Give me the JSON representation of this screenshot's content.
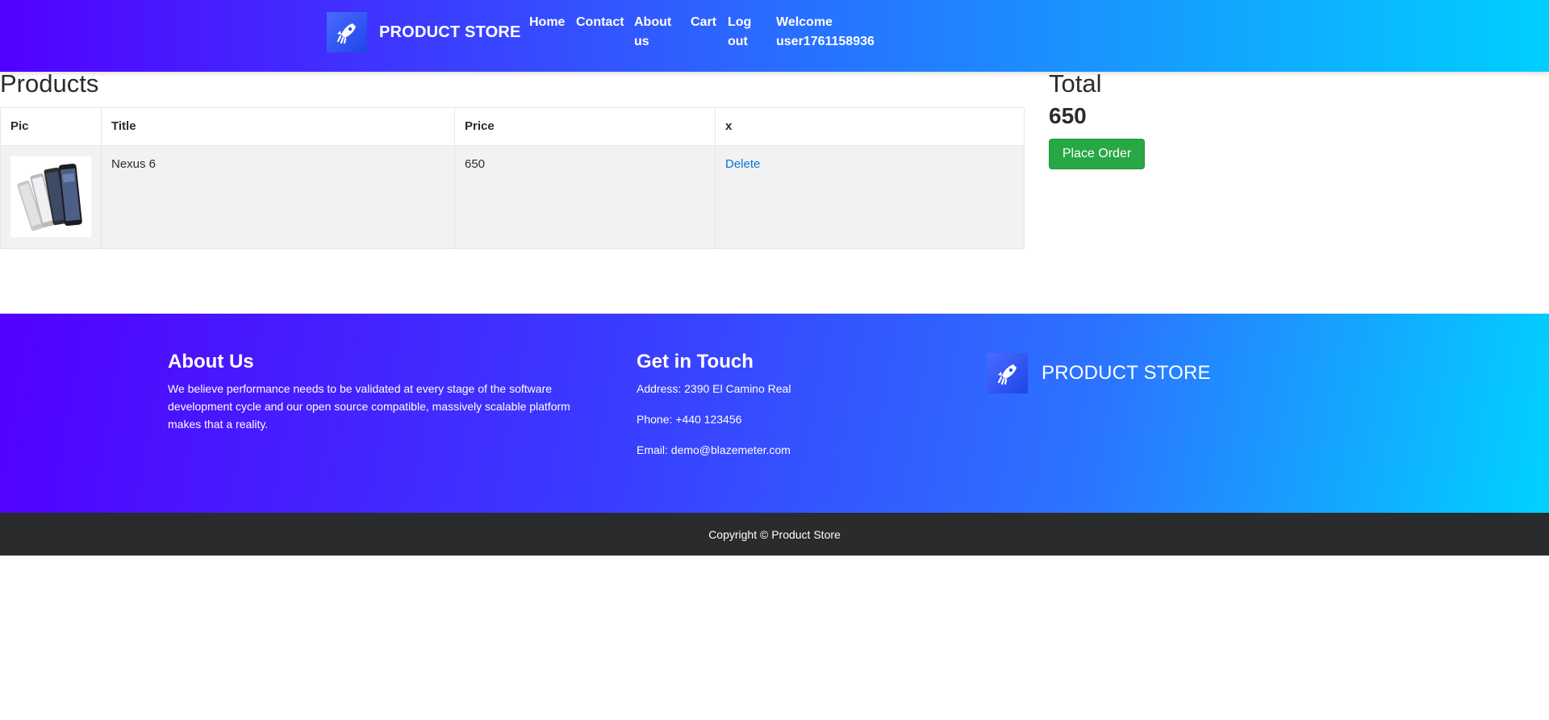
{
  "navbar": {
    "brand": "PRODUCT STORE",
    "links": [
      "Home",
      "Contact",
      "About us",
      "Cart",
      "Log out"
    ],
    "welcome": "Welcome user1761158936"
  },
  "products": {
    "title": "Products",
    "headers": [
      "Pic",
      "Title",
      "Price",
      "x"
    ],
    "rows": [
      {
        "title": "Nexus 6",
        "price": "650",
        "action": "Delete",
        "image_icon": "phones-image"
      }
    ]
  },
  "total": {
    "label": "Total",
    "value": "650",
    "button": "Place Order"
  },
  "footer": {
    "about_heading": "About Us",
    "about_text": "We believe performance needs to be validated at every stage of the software development cycle and our open source compatible, massively scalable platform makes that a reality.",
    "touch_heading": "Get in Touch",
    "address": "Address: 2390 El Camino Real",
    "phone": "Phone: +440 123456",
    "email": "Email: demo@blazemeter.com",
    "brand": "PRODUCT STORE"
  },
  "copyright": "Copyright © Product Store",
  "colors": {
    "gradient_start": "#5200ff",
    "gradient_end": "#00cfff",
    "order_button": "#28a745",
    "link": "#0275d8",
    "copyright_bg": "#292b2c"
  }
}
